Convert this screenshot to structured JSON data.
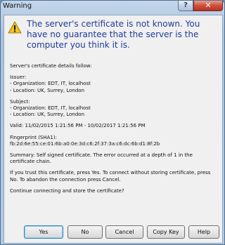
{
  "window": {
    "title": "Warning",
    "help_glyph": "?",
    "close_glyph": "✕"
  },
  "icon": "warning-triangle-icon",
  "colors": {
    "headline": "#1f3b9b",
    "warning_icon": "#f2c318"
  },
  "headline": "The server's certificate is not known. You have no guarantee that the server is the computer you think it is.",
  "details": {
    "intro": "Server's certificate details follow:",
    "issuer_label": "Issuer:",
    "issuer_org": "- Organization: EDT, IT, localhost",
    "issuer_location": "- Location: UK, Surrey, London",
    "subject_label": "Subject:",
    "subject_org": "- Organization: EDT, IT, localhost",
    "subject_location": "- Location: UK, Surrey, London",
    "valid": "Valid: 11/02/2015 1:21:56 PM - 10/02/2017 1:21:56 PM",
    "fingerprint_label": "Fingerprint (SHA1):",
    "fingerprint_value": "fb:2d:6e:55:ce:01:6b:a0:0e:3d:c6:2f:37:3a:c6:dc:6b:d1:8f:2b",
    "summary": "Summary: Self signed certificate. The error occurred at a depth of 1 in the certificate chain.",
    "instructions": "If you trust this certificate, press Yes. To connect without storing certificate, press No. To abandon the connection press Cancel.",
    "question": "Continue connecting and store the certificate?"
  },
  "buttons": {
    "yes": "Yes",
    "no": "No",
    "cancel": "Cancel",
    "copy_key": "Copy Key",
    "help": "Help"
  }
}
